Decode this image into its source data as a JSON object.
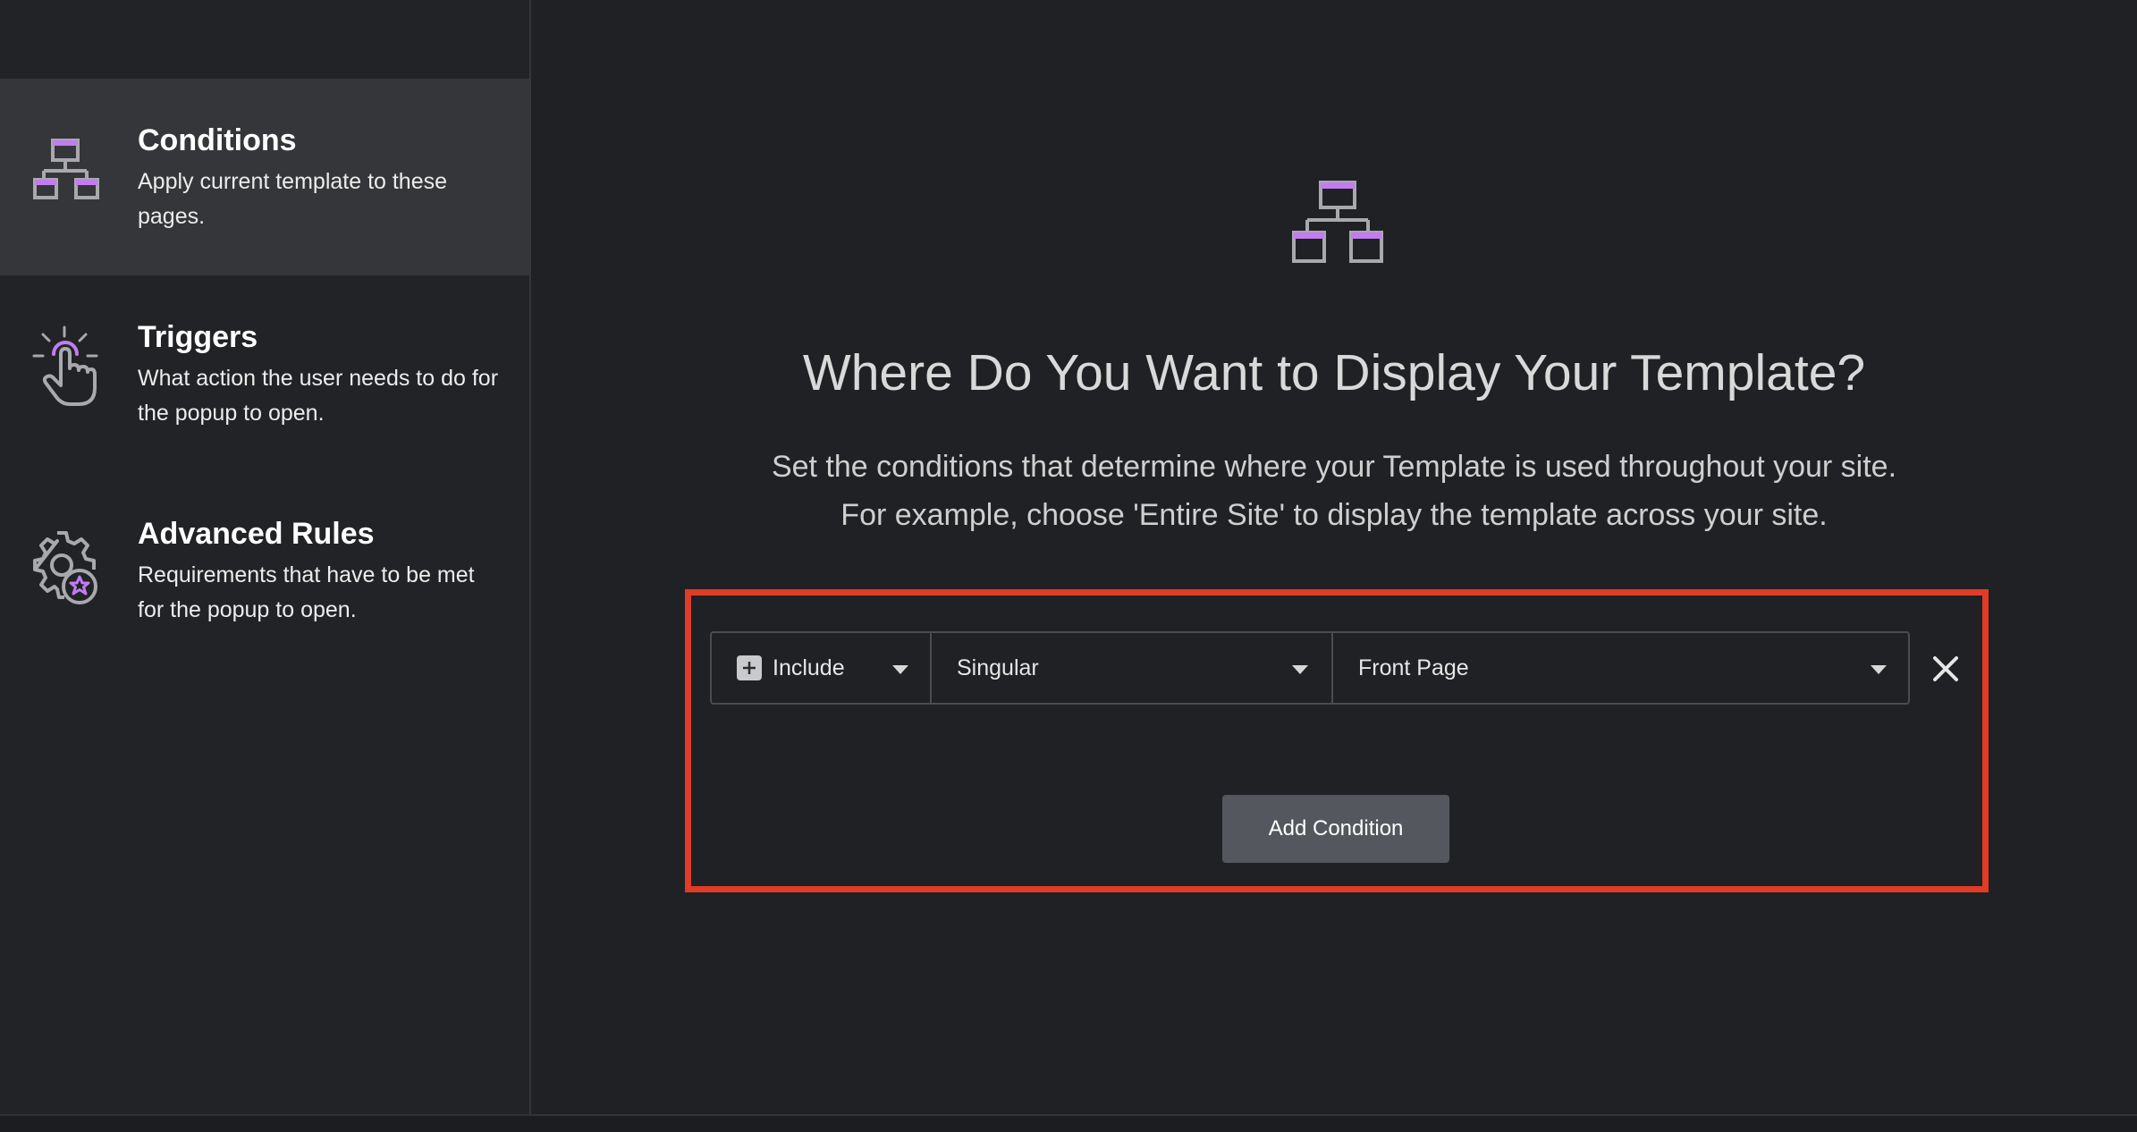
{
  "sidebar": {
    "items": [
      {
        "title": "Conditions",
        "description": "Apply current template to these pages.",
        "icon": "sitemap-icon",
        "active": true
      },
      {
        "title": "Triggers",
        "description": "What action the user needs to do for the popup to open.",
        "icon": "hand-click-icon",
        "active": false
      },
      {
        "title": "Advanced Rules",
        "description": "Requirements that have to be met for the popup to open.",
        "icon": "gear-star-icon",
        "active": false
      }
    ]
  },
  "main": {
    "icon": "sitemap-icon",
    "headline": "Where Do You Want to Display Your Template?",
    "subtitle_line1": "Set the conditions that determine where your Template is used throughout your site.",
    "subtitle_line2": "For example, choose 'Entire Site' to display the template across your site.",
    "condition": {
      "type_label": "Include",
      "type_icon": "plus-icon",
      "group_label": "Singular",
      "target_label": "Front Page",
      "remove_icon": "close-icon"
    },
    "add_condition_label": "Add Condition"
  },
  "colors": {
    "background": "#202124",
    "sidebar_active": "#353639",
    "accent_purple": "#c27cf0",
    "highlight_border": "#e03c28",
    "button_bg": "#54585e"
  }
}
